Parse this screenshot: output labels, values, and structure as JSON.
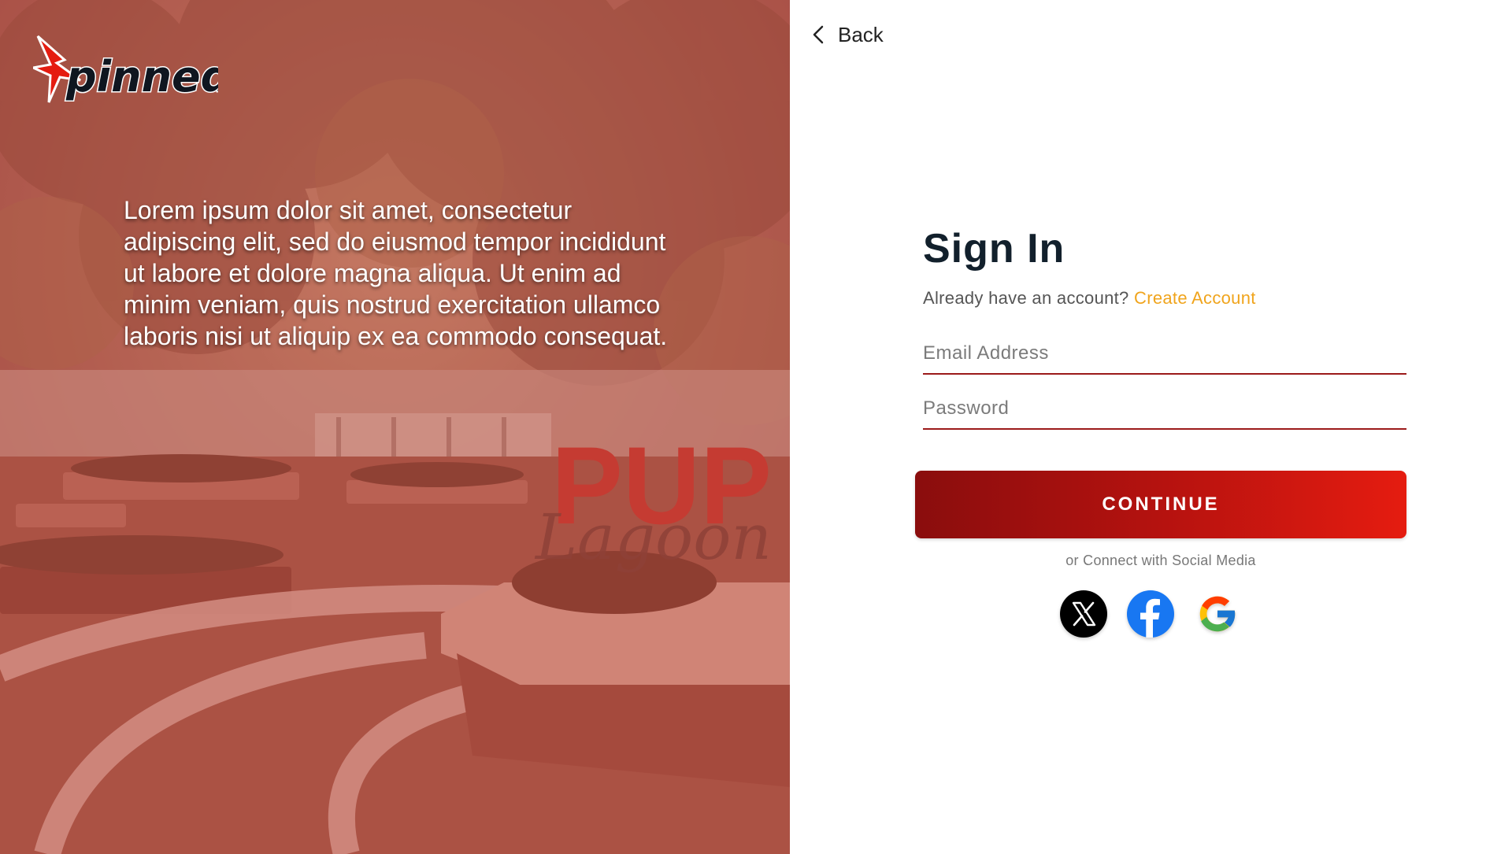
{
  "brand": {
    "logo_text": "pinned",
    "hero_text": "Lorem ipsum dolor sit amet, consectetur adipiscing elit, sed do eiusmod tempor incididunt ut labore et dolore magna aliqua. Ut enim ad minim veniam, quis nostrud exercitation ullamco laboris nisi ut aliquip ex ea commodo consequat.",
    "sign_text": "PUP",
    "sign_script": "Lagoon"
  },
  "nav": {
    "back_label": "Back",
    "back_icon": "chevron-left-icon"
  },
  "signin": {
    "title": "Sign In",
    "account_prompt": "Already have an account?",
    "create_account_label": "Create Account",
    "email_placeholder": "Email Address",
    "email_value": "",
    "password_placeholder": "Password",
    "password_value": "",
    "continue_label": "CONTINUE",
    "social_caption": "or Connect with Social Media"
  },
  "social": [
    {
      "name": "X",
      "icon": "x-icon"
    },
    {
      "name": "Facebook",
      "icon": "facebook-icon"
    },
    {
      "name": "Google",
      "icon": "google-icon"
    }
  ],
  "colors": {
    "accent": "#c8140f",
    "accent_dark": "#8a0d0d",
    "link": "#f0a41c",
    "hero_tint": "#b9645e",
    "field_underline": "#9b1a1a"
  }
}
